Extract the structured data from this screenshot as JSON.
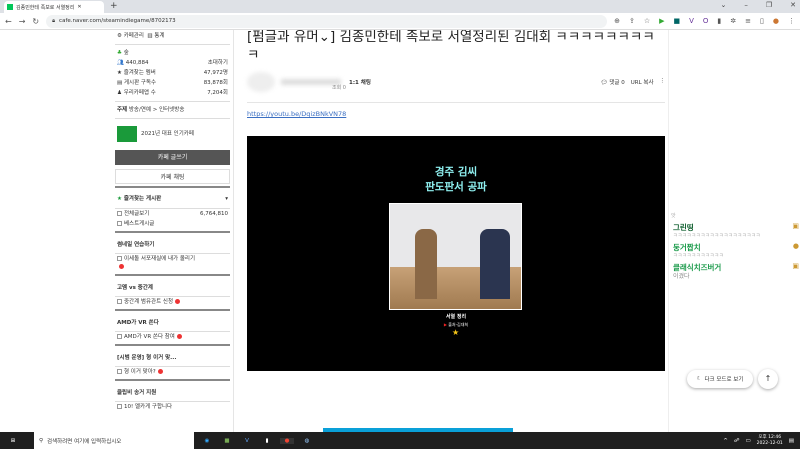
{
  "browser": {
    "tab_title": "김종민한테 족보로 서열정리",
    "url": "cafe.naver.com/steamindiegame/8702173"
  },
  "sidebar": {
    "cafe_manage": "카페관리",
    "stats": "통계",
    "level": "숲",
    "members": "440,884",
    "invite": "초대하기",
    "stats_rows": [
      {
        "label": "즐겨찾는 멤버",
        "value": "47,972명"
      },
      {
        "label": "게시판 구독수",
        "value": "83,878회"
      },
      {
        "label": "우리카페앱 수",
        "value": "7,204회"
      }
    ],
    "theme": "주제",
    "theme_value": "방송/연예 > 인터넷방송",
    "badge": "2021년 대표 인기카페",
    "badge_logo": "NAVER 대표카페",
    "write_button": "카페 글쓰기",
    "chat_button": "카페 채팅",
    "fav_header": "즐겨찾는 게시판",
    "fav_items": [
      {
        "label": "전체글보기",
        "count": "6,764,810"
      },
      {
        "label": "베스트게시글",
        "count": ""
      }
    ],
    "groups": [
      {
        "title": "썸네일 연습하기",
        "items": [
          "이세돌 서포재실에 내가 올리기"
        ]
      },
      {
        "title": "고멤 vs 중간계",
        "items": [
          "중간계 범유관트 신청"
        ]
      },
      {
        "title": "AMD가 VR 쏜다",
        "items": [
          "AMD가 VR 쏜다 참여"
        ]
      },
      {
        "title": "[시범 운영] 형 이거 맞...",
        "items": [
          "형 이거 맞아?"
        ]
      },
      {
        "title": "클립비 송거 지원",
        "items": [
          "10! 멜카게 구합니다"
        ]
      }
    ]
  },
  "post": {
    "title": "[펌글과 유머⌄] 김종민한테 족보로 서열정리된 김대회 ㅋㅋㅋㅋㅋㅋㅋㅋㅋ",
    "chat": "1:1 채팅",
    "views": "조회 0",
    "comments": "댓글 0",
    "url_copy": "URL 복사",
    "link": "https://youtu.be/DqizBNkVN78",
    "video": {
      "title1": "경주 김씨",
      "title2": "판도판서 공파",
      "caption": "서열 정리",
      "source": "출처-김대희"
    }
  },
  "comments": [
    {
      "name": "",
      "text": "앗"
    },
    {
      "name": "그린띵",
      "text": "ㅋㅋㅋㅋㅋㅋㅋㅋㅋㅋㅋㅋㅋㅋㅋㅋㅋㅋㅋ"
    },
    {
      "name": "둥거짭치",
      "text": "ㅋㅋㅋㅋㅋㅋㅋㅋㅋㅋㅋ"
    },
    {
      "name": "클래식치즈버거",
      "text": "이겼다"
    }
  ],
  "floating": {
    "dark_mode": "다크 모드로 보기"
  },
  "taskbar": {
    "search": "검색하려면 여기에 입력하십시오",
    "time": "오후 12:46",
    "date": "2022-12-01"
  }
}
